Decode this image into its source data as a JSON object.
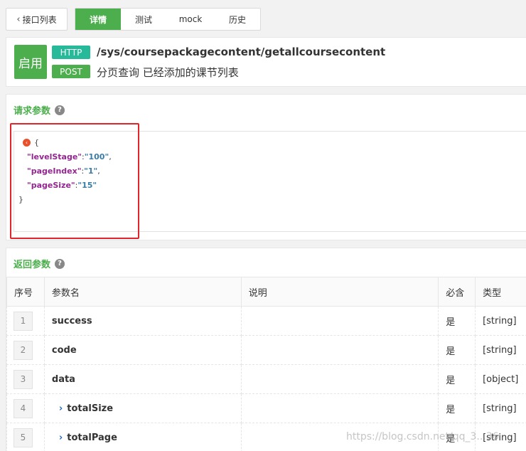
{
  "toolbar": {
    "back_label": "接口列表"
  },
  "tabs": [
    {
      "label": "详情",
      "active": true
    },
    {
      "label": "测试",
      "active": false
    },
    {
      "label": "mock",
      "active": false
    },
    {
      "label": "历史",
      "active": false
    }
  ],
  "api": {
    "status": "启用",
    "protocol": "HTTP",
    "method": "POST",
    "path": "/sys/coursepackagecontent/getallcoursecontent",
    "description": "分页查询 已经添加的课节列表"
  },
  "request": {
    "title": "请求参数",
    "json_open": "{",
    "json_close": "}",
    "params": [
      {
        "key": "\"levelStage\"",
        "value": "\"100\"",
        "sep": ":",
        "end": ","
      },
      {
        "key": "\"pageIndex\"",
        "value": "\"1\"",
        "sep": ":",
        "end": ","
      },
      {
        "key": "\"pageSize\"",
        "value": "\"15\"",
        "sep": ":",
        "end": ""
      }
    ]
  },
  "response": {
    "title": "返回参数",
    "columns": {
      "index": "序号",
      "name": "参数名",
      "desc": "说明",
      "required": "必含",
      "type": "类型"
    },
    "rows": [
      {
        "index": "1",
        "name": "success",
        "desc": "",
        "required": "是",
        "type": "[string]",
        "nested": false
      },
      {
        "index": "2",
        "name": "code",
        "desc": "",
        "required": "是",
        "type": "[string]",
        "nested": false
      },
      {
        "index": "3",
        "name": "data",
        "desc": "",
        "required": "是",
        "type": "[object]",
        "nested": false
      },
      {
        "index": "4",
        "name": "totalSize",
        "desc": "",
        "required": "是",
        "type": "[string]",
        "nested": true
      },
      {
        "index": "5",
        "name": "totalPage",
        "desc": "",
        "required": "是",
        "type": "[string]",
        "nested": true
      }
    ]
  },
  "watermark": "https://blog.csdn.net/qq_3...36",
  "colors": {
    "accent": "#4cae4c",
    "http_pill": "#26b99a",
    "highlight_box": "#e0262b"
  },
  "icons": {
    "back": "chevron-left-icon",
    "help": "question-circle-icon",
    "collapse": "collapse-icon",
    "expand": "chevron-right-icon"
  }
}
